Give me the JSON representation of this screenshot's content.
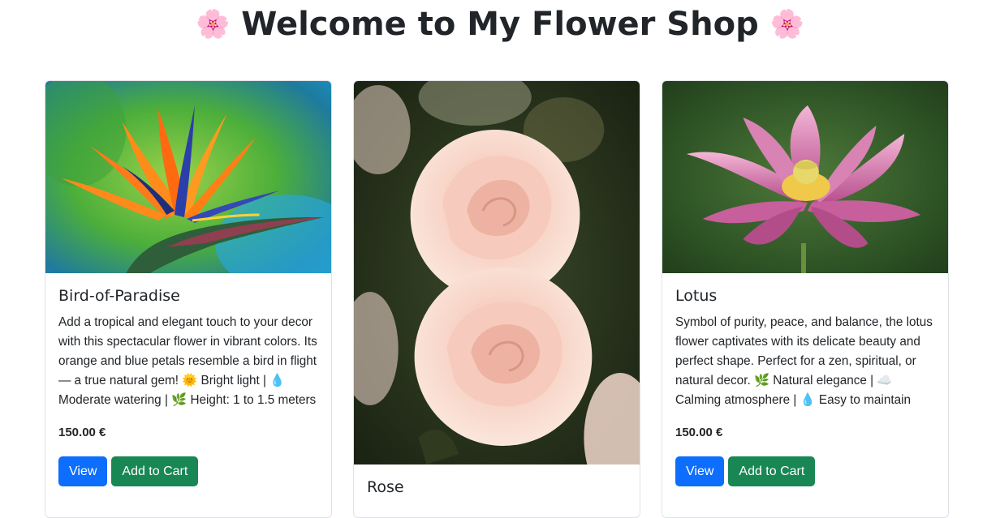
{
  "header": {
    "title": "Welcome to My Flower Shop",
    "left_icon": "🌸",
    "right_icon": "🌸"
  },
  "cards": [
    {
      "title": "Bird-of-Paradise",
      "description": "Add a tropical and elegant touch to your decor with this spectacular flower in vibrant colors. Its orange and blue petals resemble a bird in flight — a true natural gem! 🌞 Bright light | 💧 Moderate watering | 🌿 Height: 1 to 1.5 meters",
      "price": "150.00 €",
      "view_label": "View",
      "cart_label": "Add to Cart",
      "image_icon": "bird-of-paradise-photo"
    },
    {
      "title": "Rose",
      "image_icon": "rose-photo"
    },
    {
      "title": "Lotus",
      "description": "Symbol of purity, peace, and balance, the lotus flower captivates with its delicate beauty and perfect shape. Perfect for a zen, spiritual, or natural decor. 🌿 Natural elegance | ☁️ Calming atmosphere | 💧 Easy to maintain",
      "price": "150.00 €",
      "view_label": "View",
      "cart_label": "Add to Cart",
      "image_icon": "lotus-photo"
    }
  ],
  "colors": {
    "primary": "#0d6efd",
    "success": "#198754",
    "text": "#212529",
    "border": "#dfe2e6"
  }
}
